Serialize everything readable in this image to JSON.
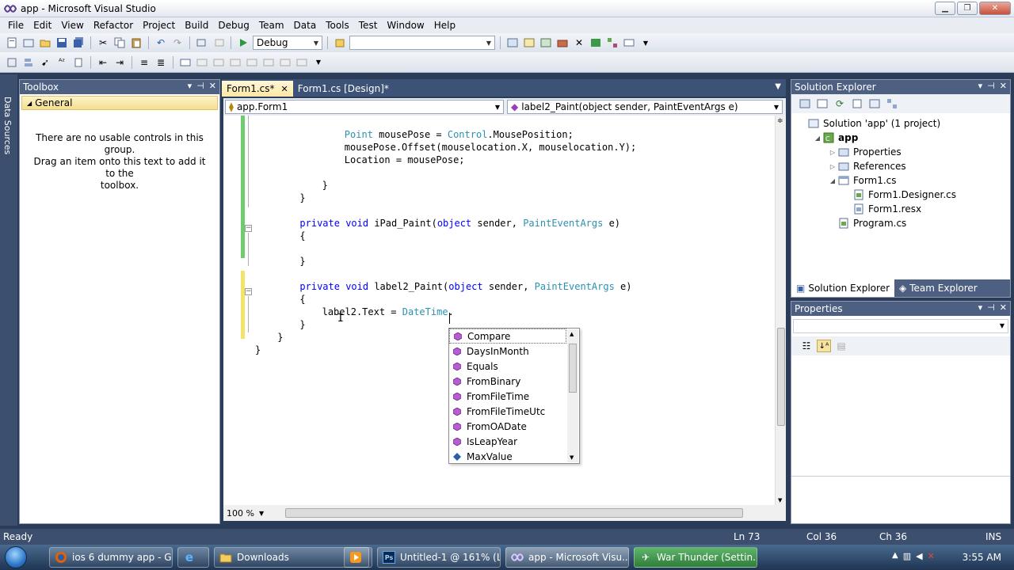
{
  "window": {
    "title": "app - Microsoft Visual Studio"
  },
  "menu": [
    "File",
    "Edit",
    "View",
    "Refactor",
    "Project",
    "Build",
    "Debug",
    "Team",
    "Data",
    "Tools",
    "Test",
    "Window",
    "Help"
  ],
  "toolbar": {
    "config": "Debug",
    "platform": ""
  },
  "sidetab": {
    "label": "Data Sources"
  },
  "toolbox": {
    "title": "Toolbox",
    "group": "General",
    "empty_line1": "There are no usable controls in this group.",
    "empty_line2": "Drag an item onto this text to add it to the",
    "empty_line3": "toolbox."
  },
  "editor": {
    "tabs": [
      {
        "label": "Form1.cs*",
        "active": true
      },
      {
        "label": "Form1.cs [Design]*",
        "active": false
      }
    ],
    "nav_class": "app.Form1",
    "nav_member": "label2_Paint(object sender, PaintEventArgs e)",
    "zoom": "100 %"
  },
  "code": [
    {
      "indent": 8,
      "parts": [
        [
          "ty",
          "Point"
        ],
        [
          "t",
          " mousePose = "
        ],
        [
          "ty",
          "Control"
        ],
        [
          "t",
          ".MousePosition;"
        ]
      ]
    },
    {
      "indent": 8,
      "parts": [
        [
          "t",
          "mousePose.Offset(mouselocation.X, mouselocation.Y);"
        ]
      ]
    },
    {
      "indent": 8,
      "parts": [
        [
          "t",
          "Location = mousePose;"
        ]
      ]
    },
    {
      "indent": 0,
      "parts": []
    },
    {
      "indent": 6,
      "parts": [
        [
          "t",
          "}"
        ]
      ]
    },
    {
      "indent": 4,
      "parts": [
        [
          "t",
          "}"
        ]
      ]
    },
    {
      "indent": 0,
      "parts": []
    },
    {
      "indent": 4,
      "parts": [
        [
          "kw",
          "private"
        ],
        [
          "t",
          " "
        ],
        [
          "kw",
          "void"
        ],
        [
          "t",
          " iPad_Paint("
        ],
        [
          "kw",
          "object"
        ],
        [
          "t",
          " sender, "
        ],
        [
          "ty",
          "PaintEventArgs"
        ],
        [
          "t",
          " e)"
        ]
      ]
    },
    {
      "indent": 4,
      "parts": [
        [
          "t",
          "{"
        ]
      ]
    },
    {
      "indent": 0,
      "parts": []
    },
    {
      "indent": 4,
      "parts": [
        [
          "t",
          "}"
        ]
      ]
    },
    {
      "indent": 0,
      "parts": []
    },
    {
      "indent": 4,
      "parts": [
        [
          "kw",
          "private"
        ],
        [
          "t",
          " "
        ],
        [
          "kw",
          "void"
        ],
        [
          "t",
          " label2_Paint("
        ],
        [
          "kw",
          "object"
        ],
        [
          "t",
          " sender, "
        ],
        [
          "ty",
          "PaintEventArgs"
        ],
        [
          "t",
          " e)"
        ]
      ]
    },
    {
      "indent": 4,
      "parts": [
        [
          "t",
          "{"
        ]
      ]
    },
    {
      "indent": 6,
      "parts": [
        [
          "t",
          "label2.Text = "
        ],
        [
          "ty",
          "DateTime"
        ],
        [
          "t",
          "."
        ]
      ]
    },
    {
      "indent": 4,
      "parts": [
        [
          "t",
          "}"
        ]
      ]
    },
    {
      "indent": 2,
      "parts": [
        [
          "t",
          "}"
        ]
      ]
    },
    {
      "indent": 0,
      "parts": [
        [
          "t",
          "}"
        ]
      ]
    }
  ],
  "intellisense": {
    "items": [
      {
        "label": "Compare",
        "icon": "method-icon",
        "selected": true
      },
      {
        "label": "DaysInMonth",
        "icon": "method-icon"
      },
      {
        "label": "Equals",
        "icon": "method-icon"
      },
      {
        "label": "FromBinary",
        "icon": "method-icon"
      },
      {
        "label": "FromFileTime",
        "icon": "method-icon"
      },
      {
        "label": "FromFileTimeUtc",
        "icon": "method-icon"
      },
      {
        "label": "FromOADate",
        "icon": "method-icon"
      },
      {
        "label": "IsLeapYear",
        "icon": "method-icon"
      },
      {
        "label": "MaxValue",
        "icon": "field-icon"
      }
    ]
  },
  "solution_explorer": {
    "title": "Solution Explorer",
    "tree": [
      {
        "label": "Solution 'app' (1 project)",
        "level": 0,
        "exp": "",
        "icon": "solution-icon"
      },
      {
        "label": "app",
        "level": 1,
        "exp": "◢",
        "icon": "project-icon",
        "bold": true
      },
      {
        "label": "Properties",
        "level": 2,
        "exp": "▷",
        "icon": "folder-icon"
      },
      {
        "label": "References",
        "level": 2,
        "exp": "▷",
        "icon": "folder-icon"
      },
      {
        "label": "Form1.cs",
        "level": 2,
        "exp": "◢",
        "icon": "form-icon"
      },
      {
        "label": "Form1.Designer.cs",
        "level": 3,
        "exp": "",
        "icon": "cs-file-icon"
      },
      {
        "label": "Form1.resx",
        "level": 3,
        "exp": "",
        "icon": "resx-file-icon"
      },
      {
        "label": "Program.cs",
        "level": 2,
        "exp": "",
        "icon": "cs-file-icon"
      }
    ],
    "tab_solution": "Solution Explorer",
    "tab_team": "Team Explorer"
  },
  "properties": {
    "title": "Properties"
  },
  "status": {
    "ready": "Ready",
    "ln": "Ln 73",
    "col": "Col 36",
    "ch": "Ch 36",
    "ins": "INS"
  },
  "taskbar": {
    "tasks": [
      {
        "label": "ios 6 dummy app - G...",
        "icon": "firefox-icon"
      },
      {
        "label": "",
        "icon": "ie-icon"
      },
      {
        "label": "Downloads",
        "icon": "folder-icon"
      },
      {
        "label": "",
        "icon": "media-player-icon"
      },
      {
        "label": "Untitled-1 @ 161% (L...",
        "icon": "photoshop-icon"
      },
      {
        "label": "app - Microsoft Visu...",
        "icon": "visual-studio-icon"
      },
      {
        "label": "War Thunder (Settin...",
        "icon": "war-thunder-icon"
      }
    ],
    "clock": "3:55 AM"
  },
  "colors": {
    "accent": "#3d5277",
    "keyword": "#0000ff",
    "type": "#2b91af",
    "toolbox_group": "#f4de8f"
  }
}
